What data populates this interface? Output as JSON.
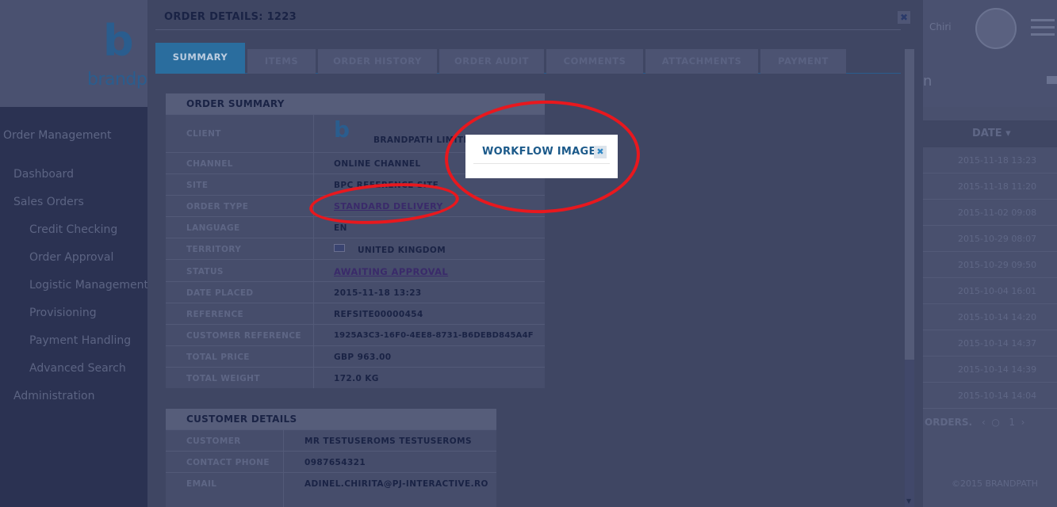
{
  "background": {
    "logo_text": "brandpath",
    "sidebar": {
      "title": "Order Management",
      "items": [
        {
          "label": "Dashboard"
        },
        {
          "label": "Sales Orders"
        },
        {
          "label": "Credit Checking"
        },
        {
          "label": "Order Approval"
        },
        {
          "label": "Logistic Management"
        },
        {
          "label": "Provisioning"
        },
        {
          "label": "Payment Handling"
        },
        {
          "label": "Advanced Search"
        },
        {
          "label": "Administration"
        }
      ]
    },
    "user_name": "Chiri",
    "page_heading_fragment": "n",
    "table": {
      "date_header": "DATE",
      "dates": [
        "2015-11-18 13:23",
        "2015-11-18 11:20",
        "2015-11-02 09:08",
        "2015-10-29 08:07",
        "2015-10-29 09:50",
        "2015-10-04 16:01",
        "2015-10-14 14:20",
        "2015-10-14 14:37",
        "2015-10-14 14:39",
        "2015-10-14 14:04"
      ]
    },
    "orders_label": "ORDERS.",
    "pager": {
      "page": "1"
    },
    "copyright": "©2015 BRANDPATH"
  },
  "modal": {
    "title": "ORDER DETAILS: 1223",
    "tabs": [
      {
        "label": "SUMMARY",
        "active": true
      },
      {
        "label": "ITEMS"
      },
      {
        "label": "ORDER HISTORY"
      },
      {
        "label": "ORDER AUDIT"
      },
      {
        "label": "COMMENTS"
      },
      {
        "label": "ATTACHMENTS"
      },
      {
        "label": "PAYMENT"
      }
    ],
    "order_summary": {
      "heading": "ORDER SUMMARY",
      "rows": [
        {
          "label": "CLIENT",
          "value": "BRANDPATH LIMITED"
        },
        {
          "label": "CHANNEL",
          "value": "ONLINE CHANNEL"
        },
        {
          "label": "SITE",
          "value": "BPC REFERENCE SITE"
        },
        {
          "label": "ORDER TYPE",
          "value": "STANDARD DELIVERY"
        },
        {
          "label": "LANGUAGE",
          "value": "EN"
        },
        {
          "label": "TERRITORY",
          "value": "UNITED KINGDOM"
        },
        {
          "label": "STATUS",
          "value": "AWAITING APPROVAL"
        },
        {
          "label": "DATE PLACED",
          "value": "2015-11-18 13:23"
        },
        {
          "label": "REFERENCE",
          "value": "REFSITE00000454"
        },
        {
          "label": "CUSTOMER REFERENCE",
          "value": "1925A3C3-16F0-4EE8-8731-B6DEBD845A4F"
        },
        {
          "label": "TOTAL PRICE",
          "value": "GBP 963.00"
        },
        {
          "label": "TOTAL WEIGHT",
          "value": "172.0 KG"
        }
      ]
    },
    "customer_details": {
      "heading": "CUSTOMER DETAILS",
      "rows": [
        {
          "label": "CUSTOMER",
          "value": "MR TESTUSEROMS TESTUSEROMS"
        },
        {
          "label": "CONTACT PHONE",
          "value": "0987654321"
        },
        {
          "label": "EMAIL",
          "value": "ADINEL.CHIRITA@PJ-INTERACTIVE.RO"
        }
      ]
    }
  },
  "popup": {
    "title": "WORKFLOW IMAGE"
  },
  "colors": {
    "annotation": "#e8181e",
    "active_tab": "#2a6d9e",
    "popup_title": "#1c5a8a"
  }
}
